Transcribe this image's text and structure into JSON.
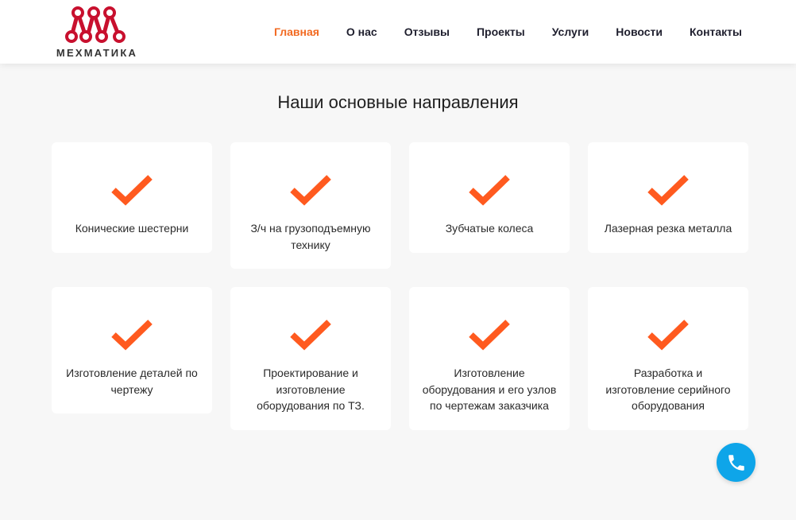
{
  "brand": {
    "name": "МЕХМАТИКА"
  },
  "nav": {
    "items": [
      {
        "label": "Главная",
        "active": true
      },
      {
        "label": "О нас",
        "active": false
      },
      {
        "label": "Отзывы",
        "active": false
      },
      {
        "label": "Проекты",
        "active": false
      },
      {
        "label": "Услуги",
        "active": false
      },
      {
        "label": "Новости",
        "active": false
      },
      {
        "label": "Контакты",
        "active": false
      }
    ]
  },
  "section": {
    "title": "Наши основные направления",
    "cards": [
      {
        "label": "Конические шестерни"
      },
      {
        "label": "З/ч на грузоподъемную технику"
      },
      {
        "label": "Зубчатые колеса"
      },
      {
        "label": "Лазерная резка металла"
      },
      {
        "label": "Изготовление деталей по чертежу"
      },
      {
        "label": "Проектирование и изготовление оборудования по ТЗ."
      },
      {
        "label": "Изготовление оборудования и его узлов по чертежам заказчика"
      },
      {
        "label": "Разработка и изготовление серийного оборудования"
      }
    ]
  },
  "colors": {
    "accent": "#f26a21",
    "check": "#ff5a1f",
    "call_button": "#0ea5e9",
    "logo_red": "#c8102e"
  },
  "icons": {
    "card_icon": "checkmark-icon",
    "call": "phone-icon"
  }
}
